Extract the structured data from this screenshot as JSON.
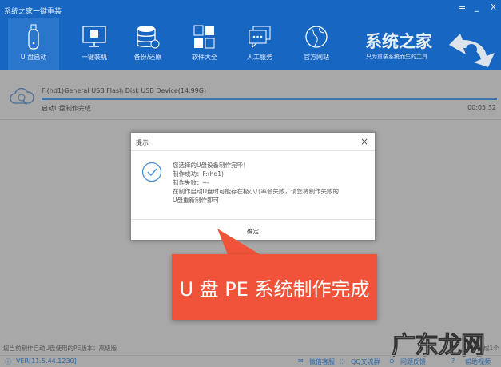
{
  "window": {
    "title": "系统之家一键重装",
    "menu": "≡",
    "minimize": "_",
    "close": "X"
  },
  "nav": [
    {
      "label": "U 盘启动",
      "icon": "usb-icon"
    },
    {
      "label": "一键装机",
      "icon": "monitor-icon"
    },
    {
      "label": "备份/还原",
      "icon": "database-icon"
    },
    {
      "label": "软件大全",
      "icon": "apps-icon"
    },
    {
      "label": "人工服务",
      "icon": "chat-icon"
    },
    {
      "label": "官方网站",
      "icon": "globe-icon"
    }
  ],
  "brand": {
    "name": "系统之家",
    "slogan": "只为重装系统而生的工具"
  },
  "task": {
    "device": "F:(hd1)General USB Flash Disk USB Device(14.99G)",
    "status": "启动U盘制作完成",
    "elapsed": "00:05:32",
    "progress_percent": 100
  },
  "dialog": {
    "title": "提示",
    "close": "×",
    "lines": [
      "您选择的U盘设备制作完毕！",
      "制作成功：F:(hd1)",
      "制作失败：---",
      "在制作启动U盘时可能存在极小几率会失败，请您将制作失败的",
      "U盘重新制作即可"
    ],
    "ok": "确定"
  },
  "banner": "U 盘 PE 系统制作完成",
  "footer": {
    "pe_version": "您当前制作启动U盘使用的PE版本：高级版",
    "done_count": "作完成1个",
    "version": "VER[11.5.44.1230]",
    "links": [
      "微信客服",
      "QQ交流群",
      "问题反馈",
      "帮助视频"
    ]
  },
  "watermark": "广东龙网"
}
